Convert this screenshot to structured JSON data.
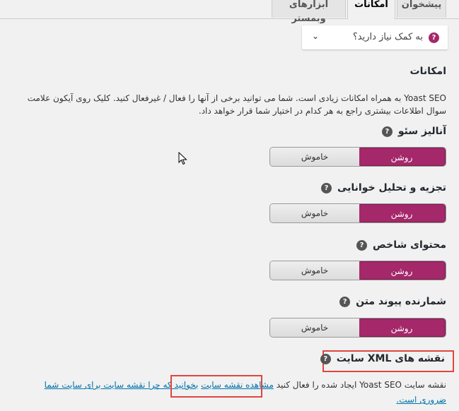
{
  "tabs": [
    {
      "label": "پیشخوان"
    },
    {
      "label": "امکانات"
    },
    {
      "label": "ابزارهای وبمستر"
    }
  ],
  "help": {
    "label": "به کمک نیاز دارید؟",
    "icon": "question-icon",
    "chevron": "chevron-down-icon"
  },
  "section": {
    "title": "امکانات",
    "description": "Yoast SEO به همراه امکانات زیادی است. شما می توانید برخی از آنها را فعال / غیرفعال کنید. کلیک روی آیکون علامت سوال اطلاعات بیشتری راجع به هر کدام در اختیار شما قرار خواهد داد."
  },
  "features": [
    {
      "label": "آنالیز سئو",
      "on": "روشن",
      "off": "خاموش"
    },
    {
      "label": "تجزیه و تحلیل خوانایی",
      "on": "روشن",
      "off": "خاموش"
    },
    {
      "label": "محتوای شاخص",
      "on": "روشن",
      "off": "خاموش"
    },
    {
      "label": "شمارنده پیوند متن",
      "on": "روشن",
      "off": "خاموش"
    }
  ],
  "xml": {
    "label": "نقشه های XML سایت",
    "text_before": "نقشه سایت Yoast SEO ایجاد شده را فعال کنید",
    "link_view": "مشاهده نقشه سایت",
    "link_more": "بخوانید که چرا نقشه سایت برای سایت شما ضروری است."
  },
  "colors": {
    "accent": "#a4286a",
    "highlight": "#e0453f",
    "link": "#0073aa"
  }
}
